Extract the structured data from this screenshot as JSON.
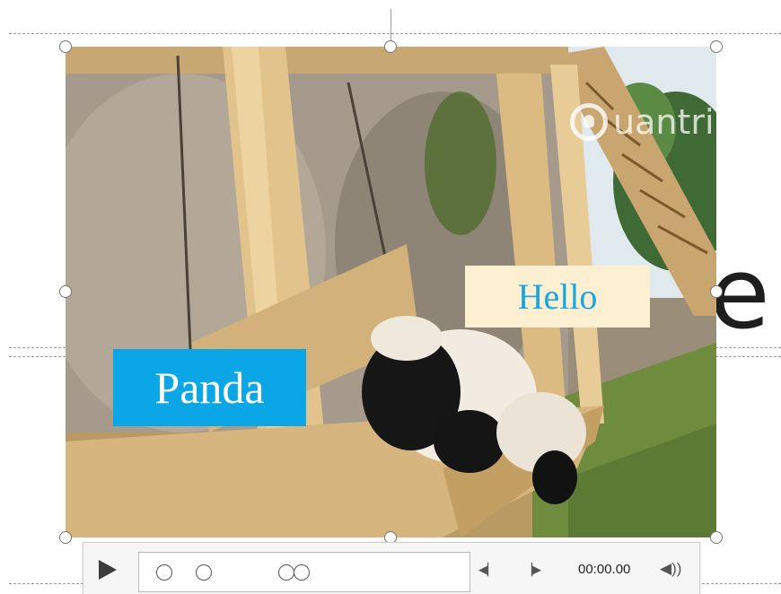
{
  "slide": {
    "background_text": "e"
  },
  "video": {
    "watermark_text": "uantrimang"
  },
  "overlays": {
    "panda_label": "Panda",
    "hello_label": "Hello"
  },
  "media_controls": {
    "time": "00:00.00",
    "play_icon": "play-icon",
    "previous_icon": "skip-back-icon",
    "next_icon": "skip-forward-icon",
    "volume_icon": "volume-icon",
    "bookmark_count": 4
  },
  "colors": {
    "panda_bg": "#0aa6e6",
    "hello_bg": "#fdf0d2",
    "hello_text": "#1aa7e0"
  }
}
